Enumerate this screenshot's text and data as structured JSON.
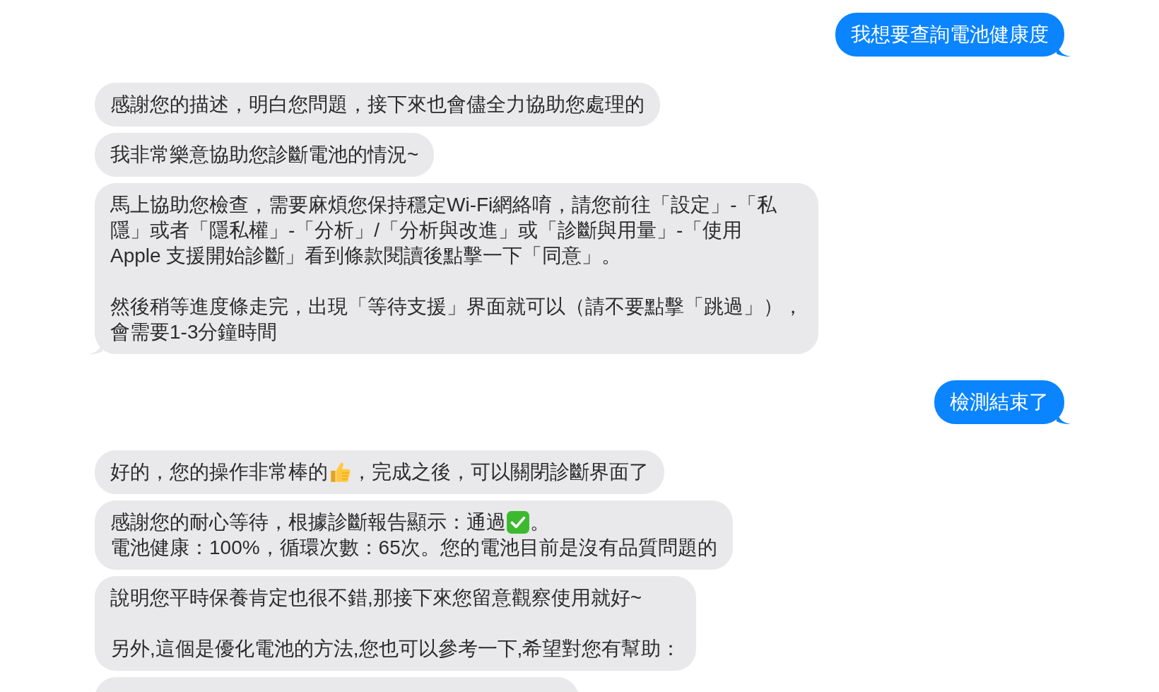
{
  "messages": [
    {
      "kind": "sent",
      "tail": true,
      "paragraphs": [
        [
          [
            {
              "kind": "text",
              "text": "我想要查詢電池健康度"
            }
          ]
        ]
      ]
    },
    {
      "kind": "received",
      "tail": false,
      "paragraphs": [
        [
          [
            {
              "kind": "text",
              "text": "感謝您的描述，明白您問題，接下來也會儘全力協助您處理的"
            }
          ]
        ]
      ]
    },
    {
      "kind": "received",
      "tail": false,
      "paragraphs": [
        [
          [
            {
              "kind": "text",
              "text": "我非常樂意協助您診斷電池的情況~"
            }
          ]
        ]
      ]
    },
    {
      "kind": "received",
      "tail": true,
      "paragraphs": [
        [
          [
            {
              "kind": "text",
              "text": "馬上協助您檢查，需要麻煩您保持穩定Wi-Fi網絡唷，請您前往「設定」-「私"
            }
          ],
          [
            {
              "kind": "text",
              "text": "隱」或者「隱私權」-「分析」/「分析與改進」或「診斷與用量」-「使用"
            }
          ],
          [
            {
              "kind": "text",
              "text": "Apple 支援開始診斷」看到條款閱讀後點擊一下「同意」。"
            }
          ]
        ],
        [
          [
            {
              "kind": "text",
              "text": "然後稍等進度條走完，出現「等待支援」界面就可以（請不要點擊「跳過」），"
            }
          ],
          [
            {
              "kind": "text",
              "text": "會需要1-3分鐘時間"
            }
          ]
        ]
      ]
    },
    {
      "kind": "sent",
      "tail": true,
      "paragraphs": [
        [
          [
            {
              "kind": "text",
              "text": "檢測結束了"
            }
          ]
        ]
      ]
    },
    {
      "kind": "received",
      "tail": false,
      "paragraphs": [
        [
          [
            {
              "kind": "text",
              "text": "好的，您的操作非常棒的"
            },
            {
              "kind": "thumbs-up"
            },
            {
              "kind": "text",
              "text": "，完成之後，可以關閉診斷界面了"
            }
          ]
        ]
      ]
    },
    {
      "kind": "received",
      "tail": false,
      "paragraphs": [
        [
          [
            {
              "kind": "text",
              "text": "感謝您的耐心等待，根據診斷報告顯示：通過"
            },
            {
              "kind": "check-mark"
            },
            {
              "kind": "text",
              "text": "。"
            }
          ],
          [
            {
              "kind": "text",
              "text": "電池健康：100%，循環次數：65次。您的電池目前是沒有品質問題的"
            }
          ]
        ]
      ]
    },
    {
      "kind": "received",
      "tail": false,
      "paragraphs": [
        [
          [
            {
              "kind": "text",
              "text": "說明您平時保養肯定也很不錯,那接下來您留意觀察使用就好~"
            }
          ]
        ],
        [
          [
            {
              "kind": "text",
              "text": "另外,這個是優化電池的方法,您也可以參考一下,希望對您有幫助："
            }
          ]
        ]
      ]
    },
    {
      "kind": "partial"
    }
  ]
}
